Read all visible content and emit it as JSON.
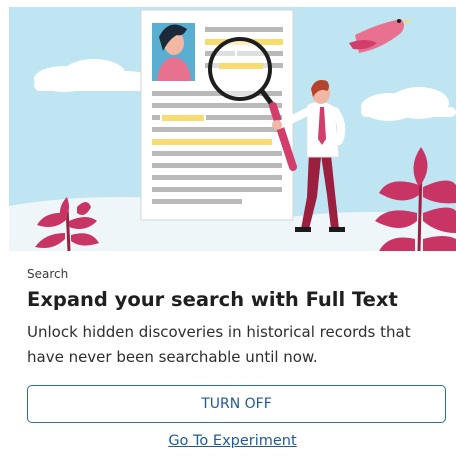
{
  "card": {
    "eyebrow": "Search",
    "title": "Expand your search with Full Text",
    "description": "Unlock hidden discoveries in historical records that have never been searchable until now.",
    "primary_button_label": "TURN OFF",
    "secondary_link_label": "Go To Experiment"
  },
  "illustration": {
    "icons": [
      "document-icon",
      "magnifying-glass-icon",
      "person-icon",
      "bird-icon",
      "cloud-icon",
      "plant-icon"
    ],
    "colors": {
      "sky": "#bfe4f2",
      "cloud": "#ffffff",
      "paper": "#ffffff",
      "text_line": "#b9b9b9",
      "highlight": "#f7dd70",
      "accent_pink": "#d33d6b",
      "dark_red": "#9b1f3f",
      "avatar_bg": "#5aaed1",
      "ground": "#e8f3f8"
    }
  },
  "colors": {
    "accent": "#1f5b99",
    "border": "#2e6aa8",
    "text": "#1f1f1f"
  }
}
